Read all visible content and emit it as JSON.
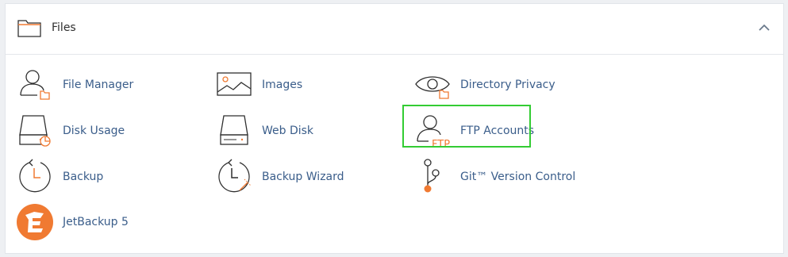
{
  "section": {
    "title": "Files",
    "header_icon": "folder-icon",
    "collapse_icon": "chevron-up-icon"
  },
  "items": [
    {
      "label": "File Manager",
      "icon": "file-manager-icon"
    },
    {
      "label": "Images",
      "icon": "images-icon"
    },
    {
      "label": "Directory Privacy",
      "icon": "directory-privacy-icon"
    },
    {
      "label": "Disk Usage",
      "icon": "disk-usage-icon"
    },
    {
      "label": "Web Disk",
      "icon": "web-disk-icon"
    },
    {
      "label": "FTP Accounts",
      "icon": "ftp-accounts-icon",
      "ftp_text": "FTP"
    },
    {
      "label": "Backup",
      "icon": "backup-icon"
    },
    {
      "label": "Backup Wizard",
      "icon": "backup-wizard-icon"
    },
    {
      "label": "Git™ Version Control",
      "icon": "git-icon"
    },
    {
      "label": "JetBackup 5",
      "icon": "jetbackup-icon"
    }
  ],
  "colors": {
    "accent_orange": "#f07a32",
    "link_blue": "#3a5d8a",
    "icon_dark": "#2f2f2f",
    "highlight_green": "#33cc33"
  }
}
